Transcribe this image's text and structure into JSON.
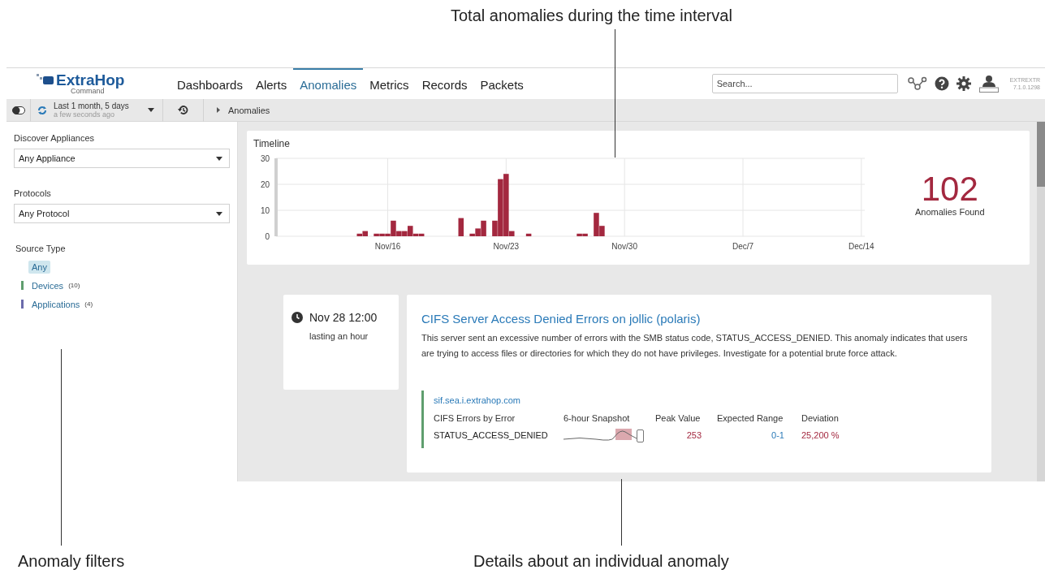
{
  "annotations": [
    {
      "kind": "top",
      "text": "Total anomalies during the time interval"
    },
    {
      "kind": "bottom-left",
      "text": "Anomaly filters"
    },
    {
      "kind": "bottom-center",
      "text": "Details about an individual anomaly"
    }
  ],
  "nav": {
    "logo": {
      "name": "ExtraHop",
      "subtitle": "Command"
    },
    "tabs": [
      {
        "label": "Dashboards",
        "selected": false
      },
      {
        "label": "Alerts",
        "selected": false
      },
      {
        "label": "Anomalies",
        "selected": true
      },
      {
        "label": "Metrics",
        "selected": false
      },
      {
        "label": "Records",
        "selected": false
      },
      {
        "label": "Packets",
        "selected": false
      }
    ],
    "search": {
      "placeholder": "Search..."
    },
    "version": {
      "line_1": "EXTREXTR",
      "line_2": "7.1.0.1298"
    }
  },
  "toolbar": {
    "time_range": "Last 1 month, 5 days",
    "updated": "a few seconds ago",
    "breadcrumb": "Anomalies"
  },
  "filters": {
    "selects": [
      {
        "label": "Discover Appliances",
        "value": "Any Appliance"
      },
      {
        "label": "Protocols",
        "value": "Any Protocol"
      }
    ],
    "source_type": {
      "label": "Source Type",
      "options": [
        {
          "label": "Any",
          "selected": true
        },
        {
          "label": "Devices",
          "count": "(10)",
          "color": "#5f9e6e",
          "selected": false
        },
        {
          "label": "Applications",
          "count": "(4)",
          "color": "#6b6bab",
          "selected": false
        }
      ]
    }
  },
  "timeline": {
    "chart_data": {
      "type": "bar",
      "title": "Timeline",
      "categories": [
        null,
        null,
        null,
        null,
        null,
        null,
        null,
        null,
        null,
        null,
        null,
        null,
        null,
        null,
        null,
        null,
        null,
        null,
        null,
        null,
        "Nov/16",
        null,
        null,
        null,
        null,
        null,
        null,
        null,
        null,
        null,
        null,
        null,
        null,
        null,
        null,
        null,
        null,
        null,
        null,
        null,
        null,
        "Nov/23",
        null,
        null,
        null,
        null,
        null,
        null,
        null,
        null,
        null,
        null,
        null,
        null,
        null,
        null,
        null,
        null,
        null,
        null,
        null,
        null,
        "Nov/30",
        null,
        null,
        null,
        null,
        null,
        null,
        null,
        null,
        null,
        null,
        null,
        null,
        null,
        null,
        null,
        null,
        null,
        null,
        null,
        null,
        "Dec/7",
        null,
        null,
        null,
        null,
        null,
        null,
        null,
        null,
        null,
        null,
        null,
        null,
        null,
        null,
        null,
        null,
        null,
        null,
        null,
        null,
        "Dec/14"
      ],
      "series": [
        {
          "color": "#a3283f",
          "values": [
            0,
            0,
            0,
            0,
            0,
            0,
            0,
            0,
            0,
            0,
            0,
            0,
            0,
            0,
            0,
            1,
            2,
            0,
            1,
            1,
            1,
            6,
            2,
            2,
            4,
            1,
            1,
            0,
            0,
            0,
            0,
            0,
            0,
            7,
            0,
            1,
            3,
            6,
            0,
            6,
            22,
            24,
            2,
            0,
            0,
            1,
            0,
            0,
            0,
            0,
            0,
            0,
            0,
            0,
            1,
            1,
            0,
            9,
            4,
            0,
            0,
            0,
            0,
            0,
            0,
            0,
            0,
            0,
            0,
            0,
            0,
            0,
            0,
            0,
            0,
            0,
            0,
            0,
            0,
            0,
            0,
            0,
            0,
            0,
            0,
            0,
            0,
            0,
            0,
            0,
            0,
            0,
            0,
            0,
            0,
            0,
            0,
            0,
            0,
            0,
            0,
            0,
            0,
            0,
            0
          ]
        }
      ],
      "ylim": [
        0,
        30
      ],
      "grid": true,
      "yticks": [
        0,
        10,
        20,
        30
      ]
    }
  },
  "summary": {
    "count": "102",
    "label": "Anomalies Found"
  },
  "anomaly": {
    "time": "Nov 28 12:00",
    "duration": "lasting an hour",
    "title": "CIFS Server Access Denied Errors on jollic (polaris)",
    "description": "This server sent an excessive number of errors with the SMB status code, STATUS_ACCESS_DENIED. This anomaly indicates that users are trying to access files or directories for which they do not have privileges. Investigate for a potential brute force attack.",
    "source": "sif.sea.i.extrahop.com",
    "columns": [
      "CIFS Errors by Error",
      "6-hour Snapshot",
      "Peak Value",
      "Expected Range",
      "Deviation"
    ],
    "row": {
      "name": "STATUS_ACCESS_DENIED",
      "peak": "253",
      "range": "0-1",
      "deviation": "25,200 %"
    }
  }
}
